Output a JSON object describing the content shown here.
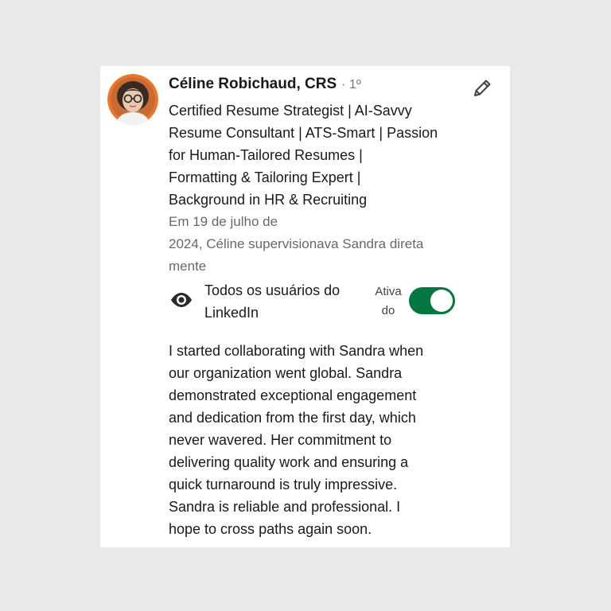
{
  "recommender": {
    "name": "Céline Robichaud, CRS",
    "degree": "· 1º",
    "headline_lines": [
      "Certified Resume Strategist | AI-Savvy",
      "Resume Consultant | ATS-Smart | Passion",
      "for Human-Tailored Resumes |",
      "Formatting & Tailoring Expert |",
      "Background in HR & Recruiting"
    ],
    "avatar_icon": "profile-photo",
    "accent_color": "#e8772e"
  },
  "meta_lines": [
    "Em 19 de julho de",
    "2024, Céline supervisionava Sandra direta",
    "mente"
  ],
  "visibility": {
    "icon": "eye-icon",
    "lines": [
      "Todos os usuários do",
      "LinkedIn"
    ],
    "toggle_label_lines": [
      "Ativa",
      "do"
    ],
    "toggle_on": true,
    "toggle_color": "#057642"
  },
  "recommendation_lines": [
    "I started collaborating with Sandra when",
    "our organization went global. Sandra",
    "demonstrated exceptional engagement",
    "and dedication from the first day, which",
    "never wavered. Her commitment to",
    "delivering quality work and ensuring a",
    "quick turnaround is truly impressive.",
    "Sandra is reliable and professional. I",
    "hope to cross paths again soon."
  ],
  "edit_icon": "pencil-icon"
}
